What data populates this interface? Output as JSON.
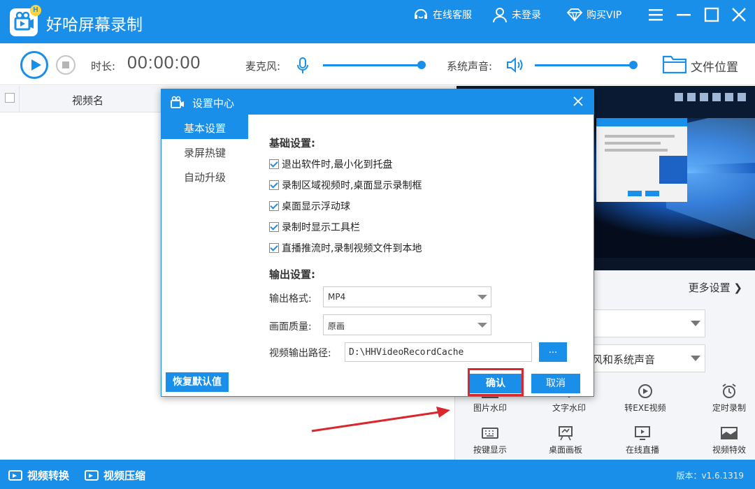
{
  "app": {
    "title": "好哈屏幕录制",
    "badge": "H",
    "online_service": "在线客服",
    "login": "未登录",
    "buy_vip": "购买VIP"
  },
  "toolbar": {
    "duration_label": "时长:",
    "duration_value": "00:00:00",
    "mic_label": "麦克风:",
    "system_sound_label": "系统声音:",
    "file_location": "文件位置"
  },
  "list": {
    "column_video_name": "视频名"
  },
  "right_panel": {
    "more_settings": "更多设置",
    "audio_select_value": "风和系统声音",
    "tools_row1": [
      "图片水印",
      "文字水印",
      "转EXE视频",
      "定时录制"
    ],
    "tools_row2": [
      "按键显示",
      "桌面画板",
      "在线直播",
      "视频特效"
    ]
  },
  "statusbar": {
    "video_convert": "视频转换",
    "video_compress": "视频压缩",
    "version": "版本：v1.6.1319"
  },
  "dialog": {
    "title": "设置中心",
    "sidebar": [
      {
        "label": "基本设置",
        "active": true
      },
      {
        "label": "录屏热键",
        "active": false
      },
      {
        "label": "自动升级",
        "active": false
      }
    ],
    "basic_section_title": "基础设置:",
    "checkboxes": [
      {
        "label": "退出软件时,最小化到托盘",
        "checked": true
      },
      {
        "label": "录制区域视频时,桌面显示录制框",
        "checked": true
      },
      {
        "label": "桌面显示浮动球",
        "checked": true
      },
      {
        "label": "录制时显示工具栏",
        "checked": true
      },
      {
        "label": "直播推流时,录制视频文件到本地",
        "checked": true
      }
    ],
    "output_section_title": "输出设置:",
    "format_label": "输出格式:",
    "format_value": "MP4",
    "quality_label": "画面质量:",
    "quality_value": "原画",
    "path_label": "视频输出路径:",
    "path_value": "D:\\HHVideoRecordCache",
    "browse": "...",
    "restore_default": "恢复默认值",
    "confirm": "确认",
    "cancel": "取消"
  },
  "colors": {
    "primary": "#1a8fea",
    "highlight_red": "#d9272d"
  }
}
